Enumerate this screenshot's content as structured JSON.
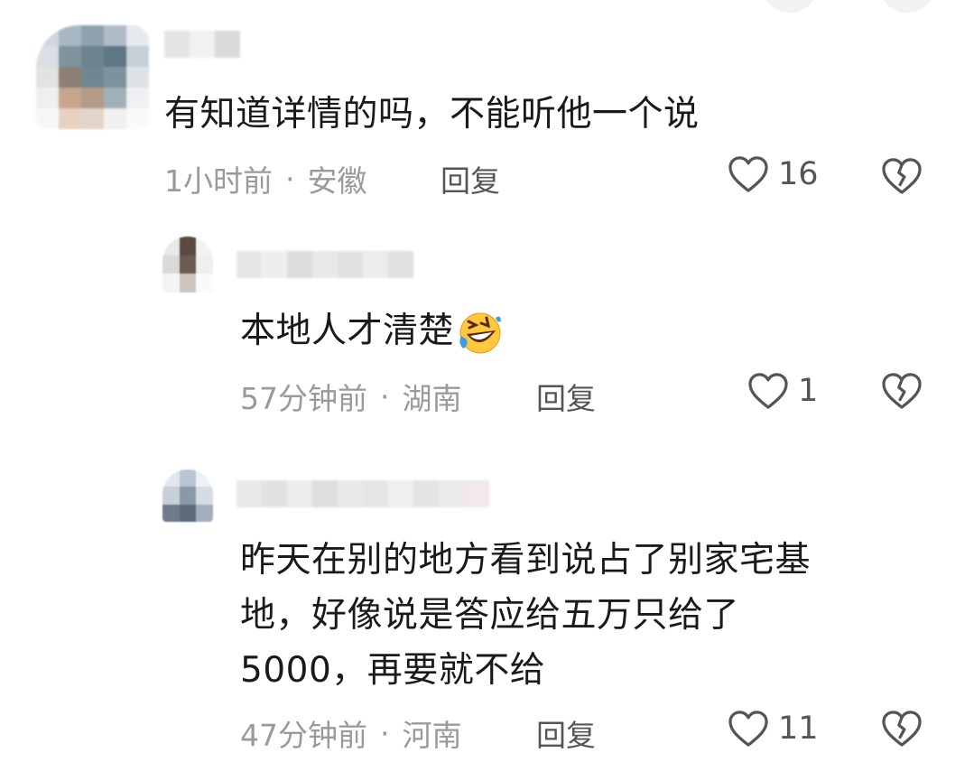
{
  "comments": [
    {
      "text": "有知道详情的吗，不能听他一个说",
      "time": "1小时前",
      "location": "安徽",
      "reply_label": "回复",
      "likes": "16"
    },
    {
      "text": "本地人才清楚",
      "emoji": "rolling-on-floor-laughing",
      "time": "57分钟前",
      "location": "湖南",
      "reply_label": "回复",
      "likes": "1"
    },
    {
      "text": "昨天在别的地方看到说占了别家宅基\n地，好像说是答应给五万只给了\n5000，再要就不给",
      "time": "47分钟前",
      "location": "河南",
      "reply_label": "回复",
      "likes": "11"
    }
  ],
  "separator": "·",
  "icons": {
    "like": "heart-outline-icon",
    "dislike": "broken-heart-icon"
  },
  "colors": {
    "text": "#1a1a1a",
    "meta": "#9a9a9a",
    "icon": "#555555"
  }
}
